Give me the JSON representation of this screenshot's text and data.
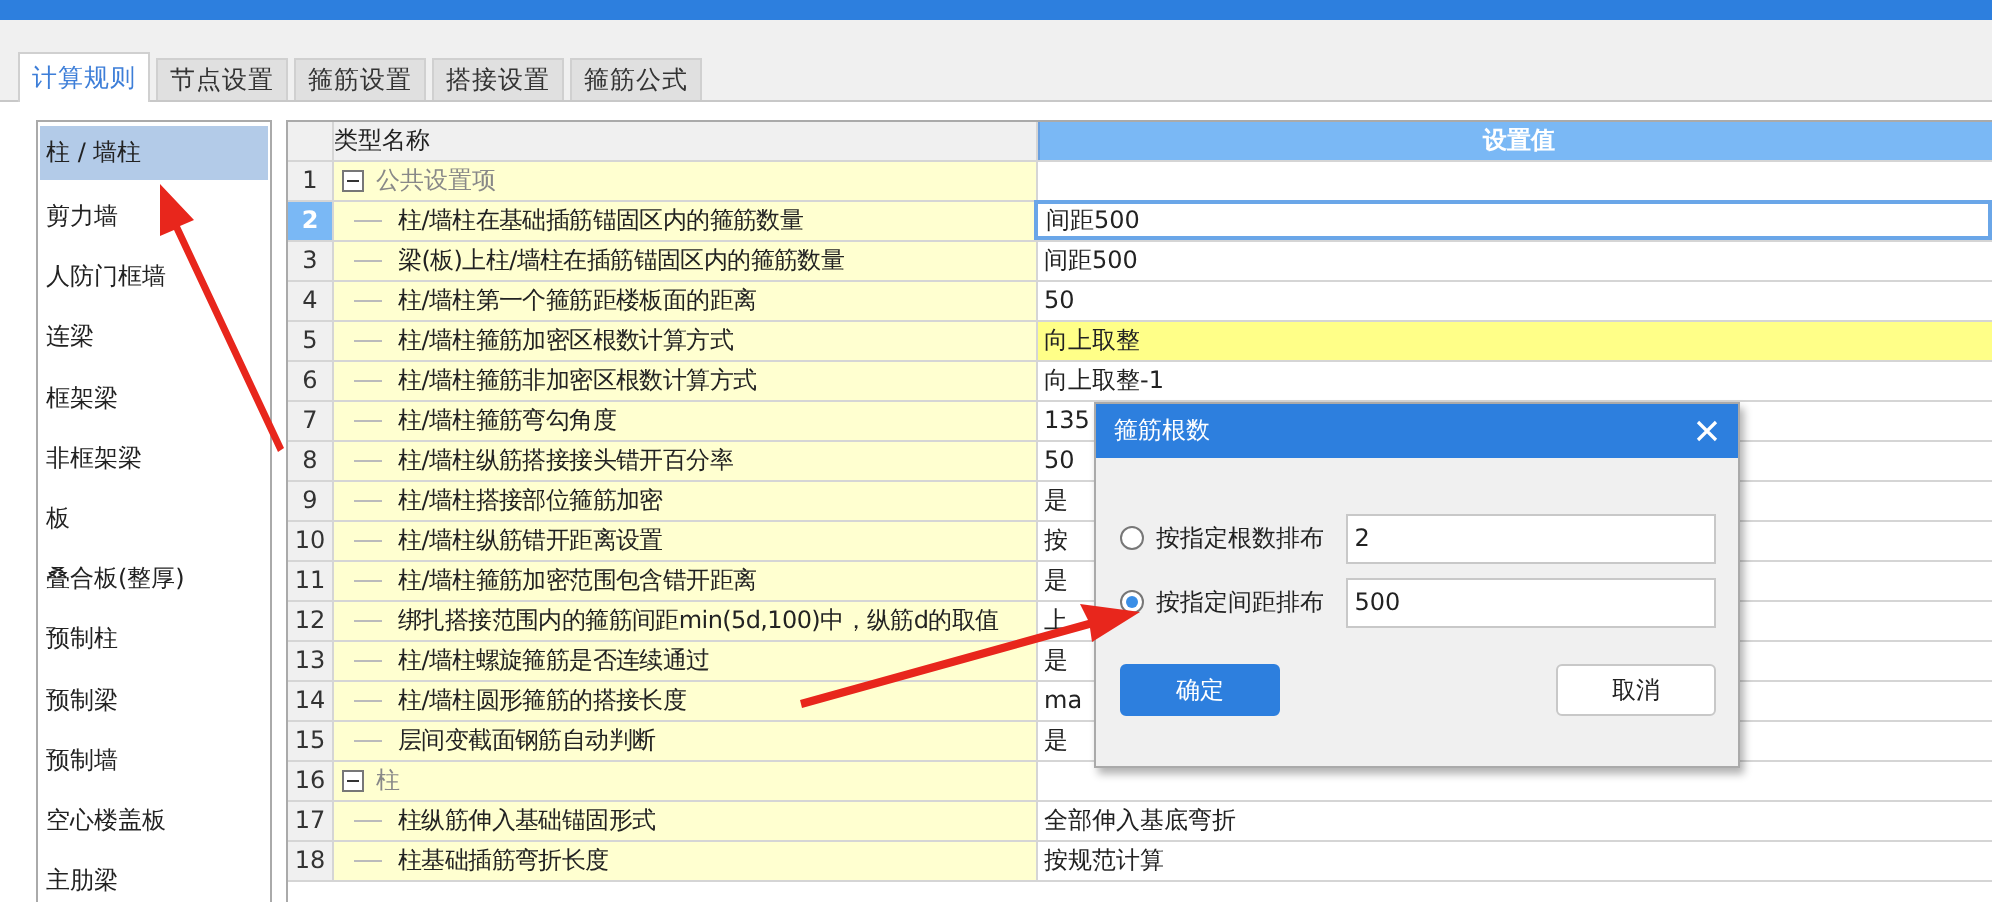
{
  "tabs": [
    {
      "label": "计算规则",
      "selected": true
    },
    {
      "label": "节点设置",
      "selected": false
    },
    {
      "label": "箍筋设置",
      "selected": false
    },
    {
      "label": "搭接设置",
      "selected": false
    },
    {
      "label": "箍筋公式",
      "selected": false
    }
  ],
  "sidebar": {
    "items": [
      {
        "label": "柱 / 墙柱",
        "selected": true
      },
      {
        "label": "剪力墙",
        "selected": false
      },
      {
        "label": "人防门框墙",
        "selected": false
      },
      {
        "label": "连梁",
        "selected": false
      },
      {
        "label": "框架梁",
        "selected": false
      },
      {
        "label": "非框架梁",
        "selected": false
      },
      {
        "label": "板",
        "selected": false
      },
      {
        "label": "叠合板(整厚)",
        "selected": false
      },
      {
        "label": "预制柱",
        "selected": false
      },
      {
        "label": "预制梁",
        "selected": false
      },
      {
        "label": "预制墙",
        "selected": false
      },
      {
        "label": "空心楼盖板",
        "selected": false
      },
      {
        "label": "主肋梁",
        "selected": false
      }
    ]
  },
  "table": {
    "columns": [
      "类型名称",
      "设置值"
    ],
    "rows": [
      {
        "number": "1",
        "kind": "group",
        "expanded": true,
        "name": "公共设置项",
        "selected": false,
        "highlighted": false
      },
      {
        "number": "2",
        "kind": "item",
        "name": "柱/墙柱在基础插筋锚固区内的箍筋数量",
        "value": "间距500",
        "selected": true,
        "highlighted": false
      },
      {
        "number": "3",
        "kind": "item",
        "name": "梁(板)上柱/墙柱在插筋锚固区内的箍筋数量",
        "value": "间距500",
        "selected": false,
        "highlighted": false
      },
      {
        "number": "4",
        "kind": "item",
        "name": "柱/墙柱第一个箍筋距楼板面的距离",
        "value": "50",
        "selected": false,
        "highlighted": false
      },
      {
        "number": "5",
        "kind": "item",
        "name": "柱/墙柱箍筋加密区根数计算方式",
        "value": "向上取整",
        "selected": false,
        "highlighted": true
      },
      {
        "number": "6",
        "kind": "item",
        "name": "柱/墙柱箍筋非加密区根数计算方式",
        "value": "向上取整-1",
        "selected": false,
        "highlighted": false
      },
      {
        "number": "7",
        "kind": "item",
        "name": "柱/墙柱箍筋弯勾角度",
        "value": "135",
        "selected": false,
        "highlighted": false
      },
      {
        "number": "8",
        "kind": "item",
        "name": "柱/墙柱纵筋搭接接头错开百分率",
        "value": "50",
        "selected": false,
        "highlighted": false
      },
      {
        "number": "9",
        "kind": "item",
        "name": "柱/墙柱搭接部位箍筋加密",
        "value": "是",
        "selected": false,
        "highlighted": false
      },
      {
        "number": "10",
        "kind": "item",
        "name": "柱/墙柱纵筋错开距离设置",
        "value": "按",
        "selected": false,
        "highlighted": false
      },
      {
        "number": "11",
        "kind": "item",
        "name": "柱/墙柱箍筋加密范围包含错开距离",
        "value": "是",
        "selected": false,
        "highlighted": false
      },
      {
        "number": "12",
        "kind": "item",
        "name": "绑扎搭接范围内的箍筋间距min(5d,100)中，纵筋d的取值",
        "value": "上",
        "selected": false,
        "highlighted": false
      },
      {
        "number": "13",
        "kind": "item",
        "name": "柱/墙柱螺旋箍筋是否连续通过",
        "value": "是",
        "selected": false,
        "highlighted": false
      },
      {
        "number": "14",
        "kind": "item",
        "name": "柱/墙柱圆形箍筋的搭接长度",
        "value": "ma",
        "selected": false,
        "highlighted": false
      },
      {
        "number": "15",
        "kind": "item",
        "name": "层间变截面钢筋自动判断",
        "value": "是",
        "selected": false,
        "highlighted": false
      },
      {
        "number": "16",
        "kind": "group",
        "expanded": true,
        "name": "柱",
        "selected": false,
        "highlighted": false
      },
      {
        "number": "17",
        "kind": "item",
        "name": "柱纵筋伸入基础锚固形式",
        "value": "全部伸入基底弯折",
        "selected": false,
        "highlighted": false
      },
      {
        "number": "18",
        "kind": "item",
        "name": "柱基础插筋弯折长度",
        "value": "按规范计算",
        "selected": false,
        "highlighted": false
      }
    ]
  },
  "dialog": {
    "title": "箍筋根数",
    "options": [
      {
        "label": "按指定根数排布",
        "value": "2",
        "selected": false
      },
      {
        "label": "按指定间距排布",
        "value": "500",
        "selected": true
      }
    ],
    "buttons": [
      {
        "label": "确定",
        "kind": "primary"
      },
      {
        "label": "取消",
        "kind": "secondary"
      }
    ]
  }
}
